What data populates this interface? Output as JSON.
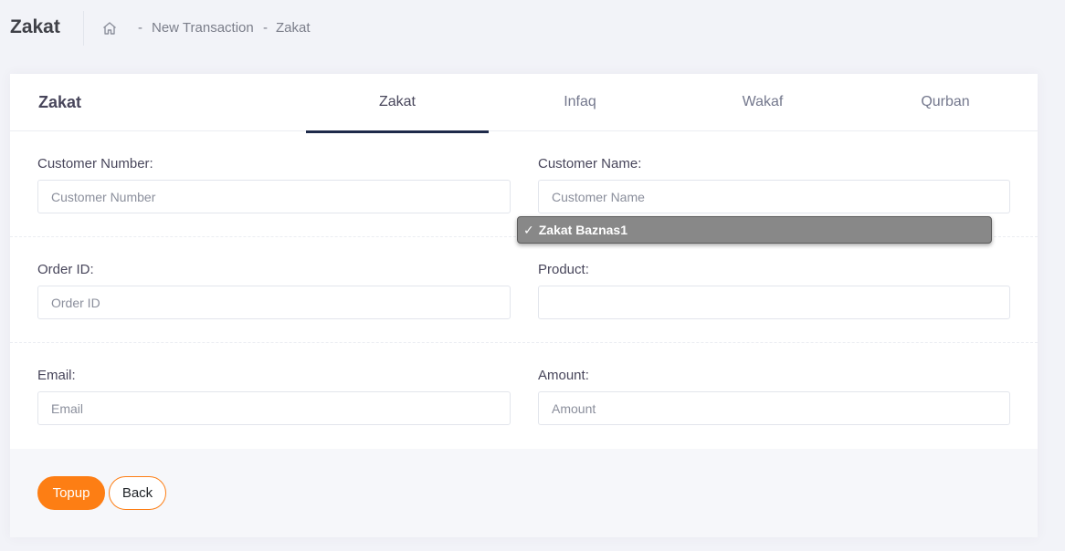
{
  "subheader": {
    "title": "Zakat",
    "breadcrumbs": [
      {
        "sep": "-",
        "label": "New Transaction"
      },
      {
        "sep": "-",
        "label": "Zakat"
      }
    ]
  },
  "card": {
    "title": "Zakat",
    "tabs": [
      {
        "label": "Zakat",
        "active": true
      },
      {
        "label": "Infaq",
        "active": false
      },
      {
        "label": "Wakaf",
        "active": false
      },
      {
        "label": "Qurban",
        "active": false
      }
    ]
  },
  "form": {
    "customer_number": {
      "label": "Customer Number:",
      "placeholder": "Customer Number",
      "value": ""
    },
    "customer_name": {
      "label": "Customer Name:",
      "placeholder": "Customer Name",
      "value": ""
    },
    "order_id": {
      "label": "Order ID:",
      "placeholder": "Order ID",
      "value": ""
    },
    "product": {
      "label": "Product:",
      "options": [
        "Zakat Baznas1"
      ],
      "selected": "Zakat Baznas1"
    },
    "email": {
      "label": "Email:",
      "placeholder": "Email",
      "value": ""
    },
    "amount": {
      "label": "Amount:",
      "placeholder": "Amount",
      "value": ""
    }
  },
  "actions": {
    "topup_label": "Topup",
    "back_label": "Back"
  },
  "colors": {
    "accent": "#fd7e14",
    "tab_underline": "#1e2a4a",
    "background": "#f2f3f8"
  },
  "icons": {
    "home": "home-icon",
    "check": "check-icon"
  }
}
